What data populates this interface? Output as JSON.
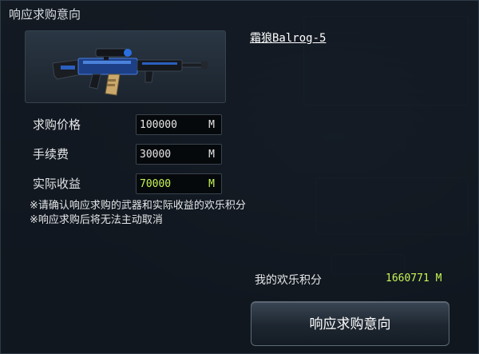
{
  "dialog": {
    "title": "响应求购意向",
    "weapon": {
      "name": "霜狼Balrog-5"
    },
    "rows": [
      {
        "label": "求购价格",
        "value": "100000",
        "unit": "M"
      },
      {
        "label": "手续费",
        "value": "30000",
        "unit": "M"
      },
      {
        "label": "实际收益",
        "value": "70000",
        "unit": "M"
      }
    ],
    "notes": [
      "※请确认响应求购的武器和实际收益的欢乐积分",
      "※响应求购后将无法主动取消"
    ],
    "balance": {
      "label": "我的欢乐积分",
      "value": "1660771 M"
    },
    "confirm_label": "响应求购意向"
  },
  "colors": {
    "accent_green": "#c6f556",
    "panel": "#121921"
  },
  "icons": {
    "weapon": "rifle-icon"
  }
}
